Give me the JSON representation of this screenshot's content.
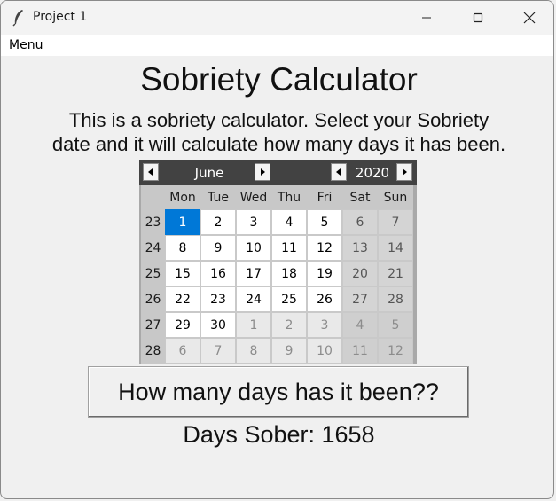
{
  "window": {
    "title": "Project 1",
    "controls": [
      "minimize-icon",
      "maximize-icon",
      "close-icon"
    ]
  },
  "menubar": {
    "menu_label": "Menu"
  },
  "main": {
    "heading": "Sobriety Calculator",
    "description_line1": "This is a sobriety calculator. Select your Sobriety",
    "description_line2": "date and it will calculate how many days it has been.",
    "button_label": "How many days has it been??",
    "result_text": "Days Sober: 1658"
  },
  "calendar": {
    "month": "June",
    "year": "2020",
    "weekdays": [
      "Mon",
      "Tue",
      "Wed",
      "Thu",
      "Fri",
      "Sat",
      "Sun"
    ],
    "weeks": [
      {
        "number": "23",
        "days": [
          "1",
          "2",
          "3",
          "4",
          "5",
          "6",
          "7"
        ],
        "other_month": [
          false,
          false,
          false,
          false,
          false,
          false,
          false
        ]
      },
      {
        "number": "24",
        "days": [
          "8",
          "9",
          "10",
          "11",
          "12",
          "13",
          "14"
        ],
        "other_month": [
          false,
          false,
          false,
          false,
          false,
          false,
          false
        ]
      },
      {
        "number": "25",
        "days": [
          "15",
          "16",
          "17",
          "18",
          "19",
          "20",
          "21"
        ],
        "other_month": [
          false,
          false,
          false,
          false,
          false,
          false,
          false
        ]
      },
      {
        "number": "26",
        "days": [
          "22",
          "23",
          "24",
          "25",
          "26",
          "27",
          "28"
        ],
        "other_month": [
          false,
          false,
          false,
          false,
          false,
          false,
          false
        ]
      },
      {
        "number": "27",
        "days": [
          "29",
          "30",
          "1",
          "2",
          "3",
          "4",
          "5"
        ],
        "other_month": [
          false,
          false,
          true,
          true,
          true,
          true,
          true
        ]
      },
      {
        "number": "28",
        "days": [
          "6",
          "7",
          "8",
          "9",
          "10",
          "11",
          "12"
        ],
        "other_month": [
          true,
          true,
          true,
          true,
          true,
          true,
          true
        ]
      }
    ],
    "selected_day": "1",
    "selected_color": "#0078d7"
  }
}
